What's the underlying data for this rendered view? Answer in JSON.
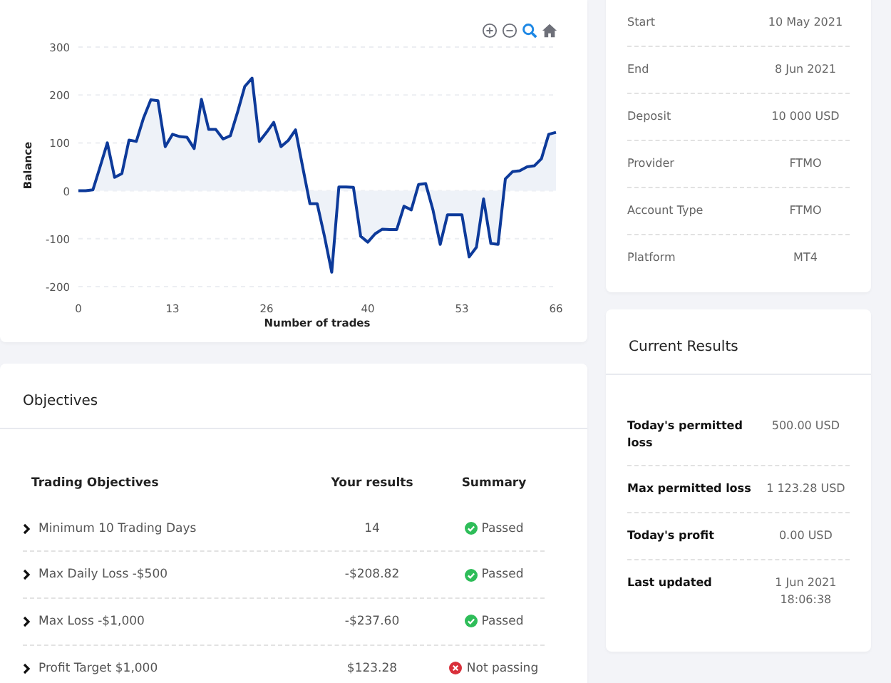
{
  "balance_chart": {
    "tools": [
      {
        "kind": "zoom_in",
        "selected": false
      },
      {
        "kind": "zoom_out",
        "selected": false
      },
      {
        "kind": "zoom",
        "selected": true
      },
      {
        "kind": "home",
        "selected": false
      }
    ],
    "chart_data": {
      "type": "area",
      "xlabel": "Number of trades",
      "ylabel": "Balance",
      "xlim": [
        0,
        66
      ],
      "ylim": [
        -200,
        300
      ],
      "grid": true,
      "xticks": [
        0,
        13,
        26,
        40,
        53,
        66
      ],
      "yticks": [
        -200,
        -100,
        0,
        100,
        200,
        300
      ],
      "x": [
        0,
        1,
        2,
        3,
        4,
        5,
        6,
        7,
        8,
        9,
        10,
        11,
        12,
        13,
        14,
        15,
        16,
        17,
        18,
        19,
        20,
        21,
        22,
        23,
        24,
        25,
        26,
        27,
        28,
        29,
        30,
        31,
        32,
        33,
        34,
        35,
        36,
        37,
        38,
        39,
        40,
        41,
        42,
        43,
        44,
        45,
        46,
        47,
        48,
        49,
        50,
        51,
        52,
        53,
        54,
        55,
        56,
        57,
        58,
        59,
        60,
        61,
        62,
        63,
        64,
        65,
        66
      ],
      "series": [
        {
          "color": "#0d3a9a",
          "values": [
            0,
            0,
            2,
            50,
            100,
            28,
            36,
            106,
            103,
            152,
            190,
            188,
            92,
            118,
            113,
            112,
            88,
            191,
            128,
            128,
            108,
            115,
            165,
            218,
            235,
            103,
            122,
            143,
            92,
            105,
            127,
            50,
            -27,
            -27,
            -95,
            -170,
            8,
            8,
            7,
            -95,
            -107,
            -90,
            -80,
            -81,
            -81,
            -32,
            -40,
            13,
            15,
            -40,
            -112,
            -50,
            -50,
            -50,
            -138,
            -118,
            -17,
            -110,
            -112,
            25,
            40,
            42,
            50,
            52,
            67,
            118,
            122
          ]
        }
      ]
    }
  },
  "objectives": {
    "title": "Objectives",
    "columns": [
      "Trading Objectives",
      "Your results",
      "Summary"
    ],
    "rows": [
      {
        "objective": "Minimum 10 Trading Days",
        "result": "14",
        "summary": "Passed",
        "passed": true
      },
      {
        "objective": "Max Daily Loss -$500",
        "result": "-$208.82",
        "summary": "Passed",
        "passed": true
      },
      {
        "objective": "Max Loss -$1,000",
        "result": "-$237.60",
        "summary": "Passed",
        "passed": true
      },
      {
        "objective": "Profit Target $1,000",
        "result": "$123.28",
        "summary": "Not passing",
        "passed": false
      }
    ]
  },
  "account_info": [
    {
      "label": "Start",
      "value": "10 May 2021"
    },
    {
      "label": "End",
      "value": "8 Jun 2021"
    },
    {
      "label": "Deposit",
      "value": "10 000 USD"
    },
    {
      "label": "Provider",
      "value": "FTMO"
    },
    {
      "label": "Account Type",
      "value": "FTMO"
    },
    {
      "label": "Platform",
      "value": "MT4"
    }
  ],
  "current_results": {
    "title": "Current Results",
    "rows": [
      {
        "label": "Today's permitted loss",
        "value": "500.00 USD"
      },
      {
        "label": "Max permitted loss",
        "value": "1 123.28 USD"
      },
      {
        "label": "Today's profit",
        "value": "0.00 USD"
      },
      {
        "label": "Last updated",
        "value": "1 Jun 2021 18:06:38"
      }
    ]
  }
}
